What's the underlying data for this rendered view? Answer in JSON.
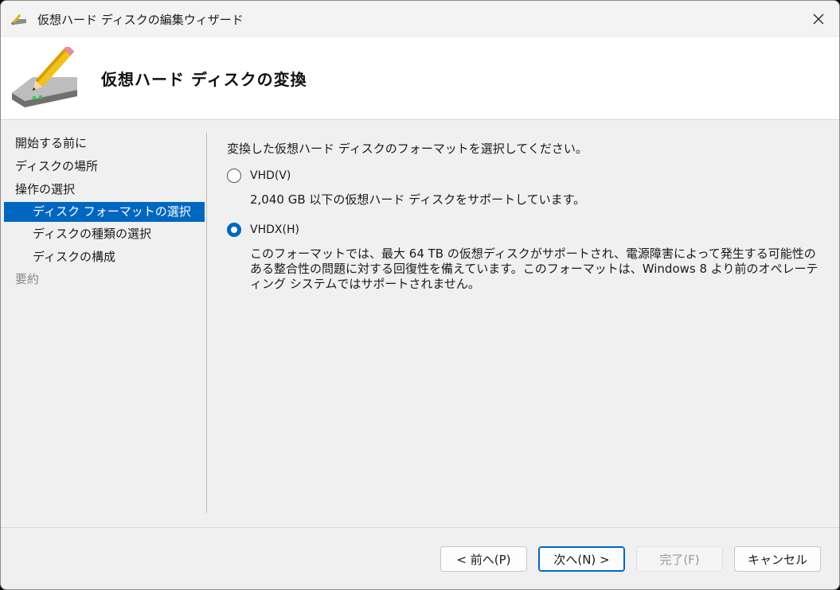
{
  "window": {
    "title": "仮想ハード ディスクの編集ウィザード"
  },
  "header": {
    "title": "仮想ハード ディスクの変換"
  },
  "nav": {
    "items": [
      {
        "label": "開始する前に",
        "state": "normal"
      },
      {
        "label": "ディスクの場所",
        "state": "normal"
      },
      {
        "label": "操作の選択",
        "state": "normal"
      },
      {
        "label": "ディスク フォーマットの選択",
        "state": "selected"
      },
      {
        "label": "ディスクの種類の選択",
        "state": "normal"
      },
      {
        "label": "ディスクの構成",
        "state": "normal"
      },
      {
        "label": "要約",
        "state": "disabled"
      }
    ]
  },
  "content": {
    "prompt": "変換した仮想ハード ディスクのフォーマットを選択してください。",
    "options": [
      {
        "label": "VHD(V)",
        "checked": false,
        "description": "2,040 GB 以下の仮想ハード ディスクをサポートしています。"
      },
      {
        "label": "VHDX(H)",
        "checked": true,
        "description_lines": [
          "このフォーマットでは、最大 64 TB の仮想ディスクがサポートされ、電源障害によって発生する可能性の",
          "ある整合性の問題に対する回復性を備えています。このフォーマットは、Windows 8 より前のオペレーテ",
          "ィング システムではサポートされません。"
        ]
      }
    ]
  },
  "buttons": {
    "previous": "< 前へ(P)",
    "next": "次へ(N) >",
    "finish": "完了(F)",
    "cancel": "キャンセル"
  },
  "colors": {
    "accent": "#0067c0",
    "window_bg": "#f0f0f0",
    "header_bg": "#ffffff"
  }
}
